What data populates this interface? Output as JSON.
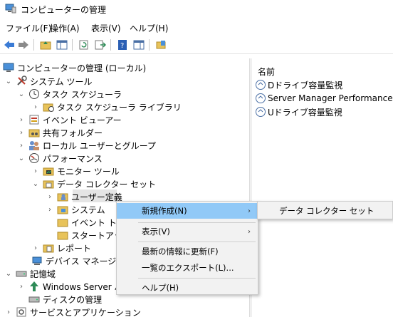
{
  "window": {
    "title": "コンピューターの管理"
  },
  "menubar": [
    "ファイル(F)",
    "操作(A)",
    "表示(V)",
    "ヘルプ(H)"
  ],
  "toolbar": {
    "icons": [
      "back-icon",
      "forward-icon",
      "folder-up-icon",
      "show-hide-tree-icon",
      "refresh-icon",
      "export-list-icon",
      "help-icon",
      "properties-icon",
      "action-pane-icon"
    ]
  },
  "tree": {
    "root": "コンピューターの管理 (ローカル)",
    "system_tools": "システム ツール",
    "task_scheduler": "タスク スケジューラ",
    "task_scheduler_library": "タスク スケジューラ ライブラリ",
    "event_viewer": "イベント ビューアー",
    "shared_folders": "共有フォルダー",
    "local_users": "ローカル ユーザーとグループ",
    "performance": "パフォーマンス",
    "monitor_tools": "モニター ツール",
    "data_collector_sets": "データ コレクター セット",
    "user_defined": "ユーザー定義",
    "system": "システム",
    "event_trace": "イベント トレー",
    "startup": "スタートアップ",
    "reports": "レポート",
    "device_manager": "デバイス マネージャー",
    "storage": "記憶域",
    "windows_server": "Windows Server バ",
    "disk_management": "ディスクの管理",
    "services_apps": "サービスとアプリケーション"
  },
  "list": {
    "column_header": "名前",
    "items": [
      "Dドライブ容量監視",
      "Server Manager Performance M...",
      "Uドライブ容量監視"
    ]
  },
  "context_menu": {
    "new": "新規作成(N)",
    "view": "表示(V)",
    "refresh": "最新の情報に更新(F)",
    "export": "一覧のエクスポート(L)...",
    "help": "ヘルプ(H)"
  },
  "sub_menu": {
    "data_collector_set": "データ コレクター セット"
  },
  "colors": {
    "selection": "#e5e5e5",
    "menu_hover": "#91c9f7",
    "menu_bg": "#f2f2f2"
  }
}
